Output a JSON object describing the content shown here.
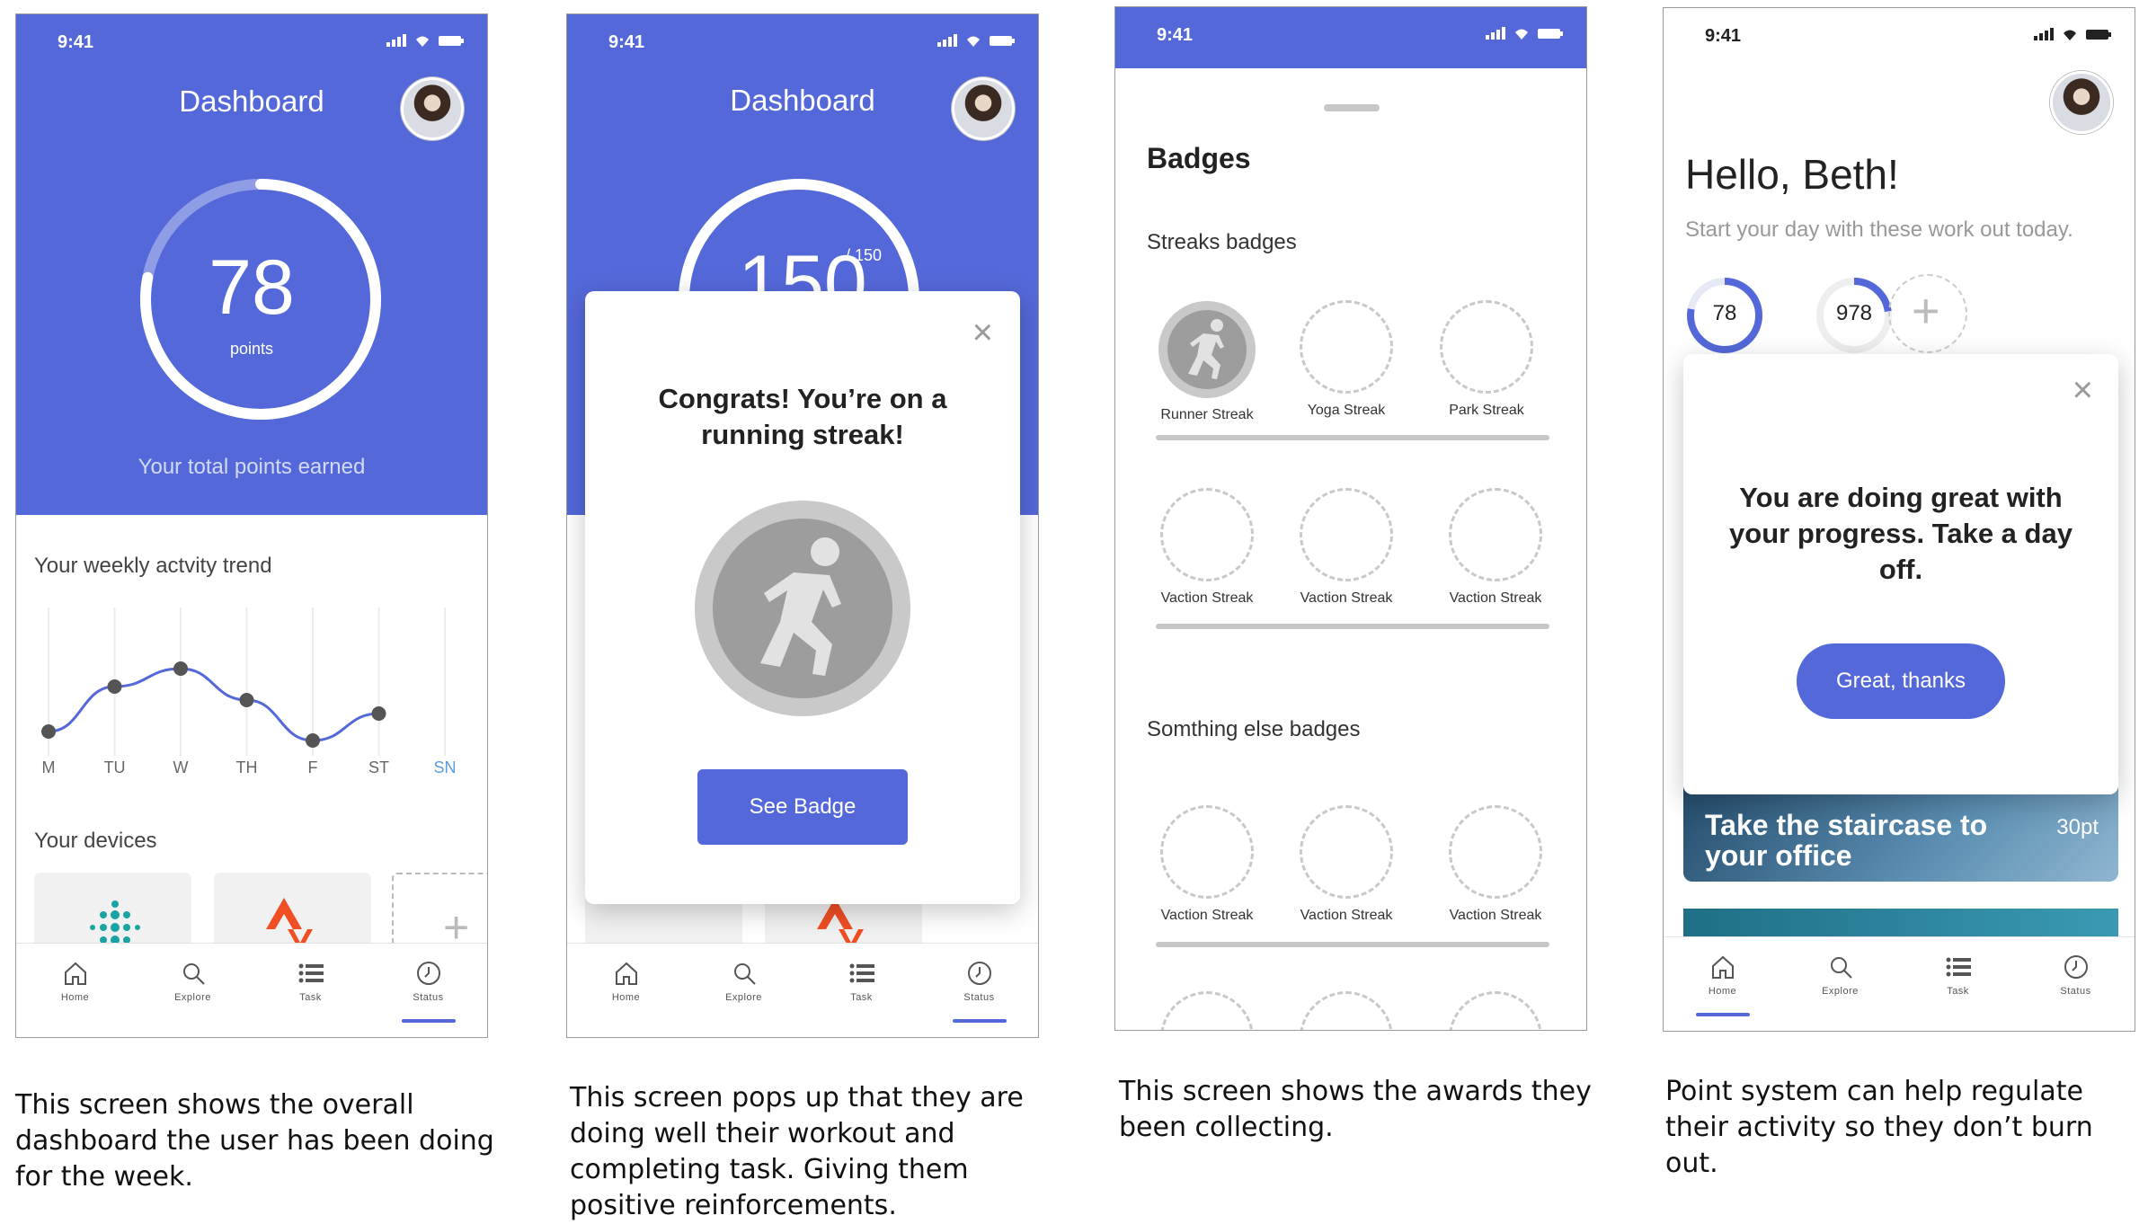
{
  "colors": {
    "accent": "#5468d9",
    "muted": "#c7c7c7"
  },
  "status_bar": {
    "time": "9:41"
  },
  "screen1": {
    "title": "Dashboard",
    "points_value": "78",
    "points_unit": "points",
    "points_progress": 0.78,
    "points_caption": "Your total points earned",
    "trend_title": "Your weekly actvity trend",
    "days": [
      "M",
      "TU",
      "W",
      "TH",
      "F",
      "ST",
      "SN"
    ],
    "trend_levels": [
      0.0,
      0.5,
      0.7,
      0.35,
      -0.1,
      0.2
    ],
    "devices_title": "Your devices",
    "nav": [
      {
        "label": "Home",
        "icon": "home-icon"
      },
      {
        "label": "Explore",
        "icon": "search-icon"
      },
      {
        "label": "Task",
        "icon": "list-icon"
      },
      {
        "label": "Status",
        "icon": "clock-icon"
      }
    ],
    "caption": "This screen shows the overall dashboard the user has been doing for the week."
  },
  "screen2": {
    "title": "Dashboard",
    "points_value": "150",
    "points_total": "/ 150",
    "modal_text": "Congrats! You’re on a running streak!",
    "button": "See Badge",
    "caption": "This screen pops up that they are doing well their workout and completing task. Giving them positive reinforcements."
  },
  "screen3": {
    "title": "Badges",
    "section1": "Streaks badges",
    "row1": [
      "Runner Streak",
      "Yoga Streak",
      "Park Streak"
    ],
    "row2": [
      "Vaction Streak",
      "Vaction Streak",
      "Vaction Streak"
    ],
    "section2": "Somthing else badges",
    "row3": [
      "Vaction Streak",
      "Vaction Streak",
      "Vaction Streak"
    ],
    "caption": "This screen shows the awards they been collecting."
  },
  "screen4": {
    "greeting": "Hello, Beth!",
    "subtitle": "Start your day with these work out today.",
    "ring1": "78",
    "ring2": "978",
    "modal_text": "You are doing great with your progress. Take a day off.",
    "button": "Great, thanks",
    "card_title": "Take the staircase to your office",
    "card_points": "30pt",
    "caption": "Point system can help regulate their activity so they don’t burn out."
  }
}
